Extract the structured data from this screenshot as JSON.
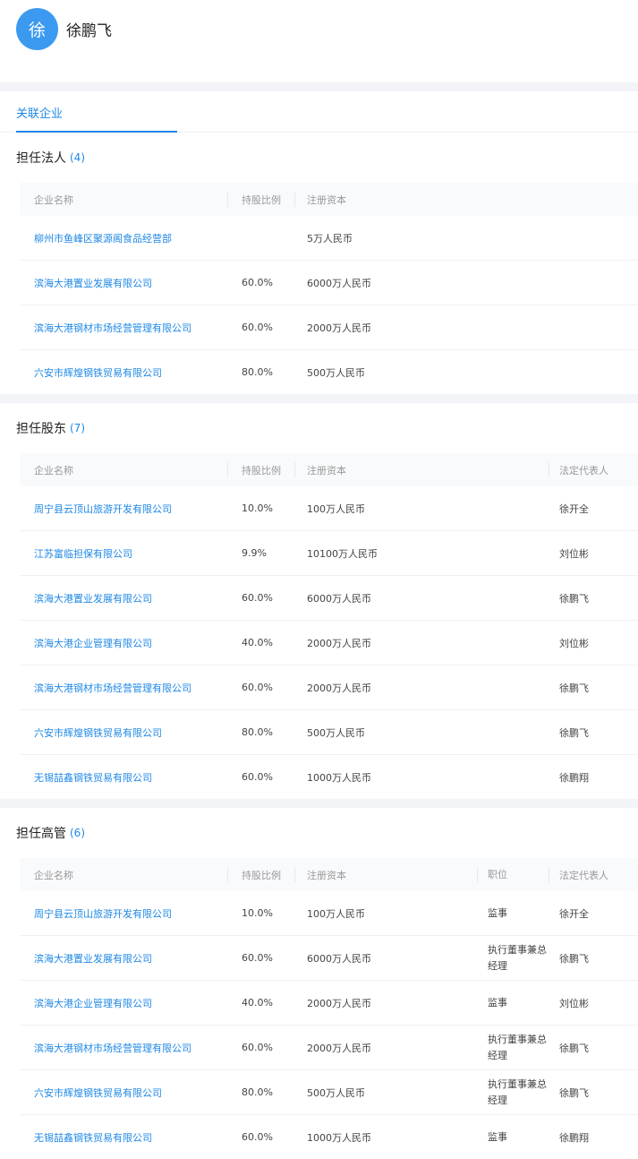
{
  "profile": {
    "avatar_char": "徐",
    "name": "徐鹏飞"
  },
  "tabs": [
    {
      "label": "关联企业"
    }
  ],
  "legal_rep": {
    "title": "担任法人",
    "count": "(4)",
    "headers": {
      "name": "企业名称",
      "share": "持股比例",
      "capital": "注册资本"
    },
    "rows": [
      {
        "name": "柳州市鱼峰区聚源阁食品经营部",
        "share": "",
        "capital": "5万人民币"
      },
      {
        "name": "滨海大港置业发展有限公司",
        "share": "60.0%",
        "capital": "6000万人民币"
      },
      {
        "name": "滨海大港钢材市场经营管理有限公司",
        "share": "60.0%",
        "capital": "2000万人民币"
      },
      {
        "name": "六安市辉煌钢铁贸易有限公司",
        "share": "80.0%",
        "capital": "500万人民币"
      }
    ]
  },
  "shareholder": {
    "title": "担任股东",
    "count": "(7)",
    "headers": {
      "name": "企业名称",
      "share": "持股比例",
      "capital": "注册资本",
      "rep": "法定代表人"
    },
    "rows": [
      {
        "name": "周宁县云顶山旅游开发有限公司",
        "share": "10.0%",
        "capital": "100万人民币",
        "rep": "徐开全"
      },
      {
        "name": "江苏富临担保有限公司",
        "share": "9.9%",
        "capital": "10100万人民币",
        "rep": "刘位彬"
      },
      {
        "name": "滨海大港置业发展有限公司",
        "share": "60.0%",
        "capital": "6000万人民币",
        "rep": "徐鹏飞"
      },
      {
        "name": "滨海大港企业管理有限公司",
        "share": "40.0%",
        "capital": "2000万人民币",
        "rep": "刘位彬"
      },
      {
        "name": "滨海大港钢材市场经营管理有限公司",
        "share": "60.0%",
        "capital": "2000万人民币",
        "rep": "徐鹏飞"
      },
      {
        "name": "六安市辉煌钢铁贸易有限公司",
        "share": "80.0%",
        "capital": "500万人民币",
        "rep": "徐鹏飞"
      },
      {
        "name": "无锡喆鑫钢铁贸易有限公司",
        "share": "60.0%",
        "capital": "1000万人民币",
        "rep": "徐鹏翔"
      }
    ]
  },
  "executive": {
    "title": "担任高管",
    "count": "(6)",
    "headers": {
      "name": "企业名称",
      "share": "持股比例",
      "capital": "注册资本",
      "position": "职位",
      "rep": "法定代表人"
    },
    "rows": [
      {
        "name": "周宁县云顶山旅游开发有限公司",
        "share": "10.0%",
        "capital": "100万人民币",
        "position": "监事",
        "rep": "徐开全"
      },
      {
        "name": "滨海大港置业发展有限公司",
        "share": "60.0%",
        "capital": "6000万人民币",
        "position": "执行董事兼总经理",
        "rep": "徐鹏飞"
      },
      {
        "name": "滨海大港企业管理有限公司",
        "share": "40.0%",
        "capital": "2000万人民币",
        "position": "监事",
        "rep": "刘位彬"
      },
      {
        "name": "滨海大港钢材市场经营管理有限公司",
        "share": "60.0%",
        "capital": "2000万人民币",
        "position": "执行董事兼总经理",
        "rep": "徐鹏飞"
      },
      {
        "name": "六安市辉煌钢铁贸易有限公司",
        "share": "80.0%",
        "capital": "500万人民币",
        "position": "执行董事兼总经理",
        "rep": "徐鹏飞"
      },
      {
        "name": "无锡喆鑫钢铁贸易有限公司",
        "share": "60.0%",
        "capital": "1000万人民币",
        "position": "监事",
        "rep": "徐鹏翔"
      }
    ]
  }
}
